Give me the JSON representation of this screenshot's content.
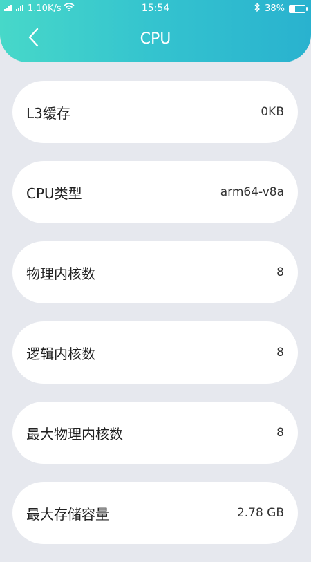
{
  "status_bar": {
    "network_left": "46",
    "network_right": "4G",
    "speed": "1.10K/s",
    "time": "15:54",
    "battery": "38%",
    "battery_level": 0.38
  },
  "header": {
    "title": "CPU"
  },
  "items": [
    {
      "label": "L3缓存",
      "value": "0KB"
    },
    {
      "label": "CPU类型",
      "value": "arm64-v8a"
    },
    {
      "label": "物理内核数",
      "value": "8"
    },
    {
      "label": "逻辑内核数",
      "value": "8"
    },
    {
      "label": "最大物理内核数",
      "value": "8"
    },
    {
      "label": "最大存储容量",
      "value": "2.78 GB"
    }
  ],
  "colors": {
    "header_gradient_start": "#47d8c9",
    "header_gradient_end": "#29b2cf",
    "background": "#e6e8ee"
  }
}
